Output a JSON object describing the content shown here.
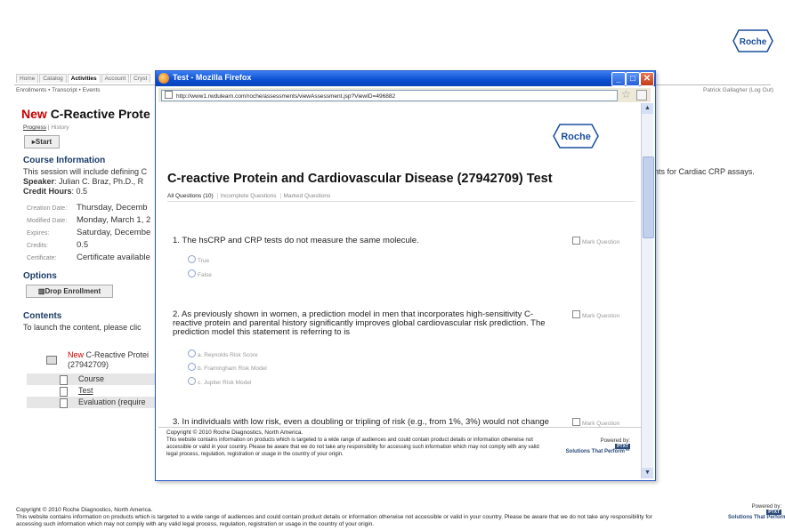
{
  "brand": {
    "logo_text": "Roche",
    "logo_color": "#1a4f9c"
  },
  "nav": {
    "tabs": [
      "Home",
      "Catalog",
      "Activities",
      "Account",
      "Cryst"
    ],
    "active_index": 2
  },
  "subnav": "Enrollments • Transcript • Events",
  "user": "Patrick Gallagher (Log Out)",
  "course": {
    "new_label": "New",
    "title": "C-Reactive Prote",
    "tabs": {
      "progress": "Progress",
      "history": "History"
    },
    "start_label": "Start",
    "info_heading": "Course Information",
    "info_intro": "This session will include defining C",
    "info_tail": "ents for Cardiac CRP assays.",
    "speaker_label": "Speaker",
    "speaker_value": ": Julian C. Braz, Ph.D., R",
    "credit_label": "Credit Hours",
    "credit_value": ": 0.5",
    "details": [
      {
        "key": "Creation Date:",
        "value": "Thursday, Decemb"
      },
      {
        "key": "Modified Date:",
        "value": "Monday, March 1, 2"
      },
      {
        "key": "Expires:",
        "value": "Saturday, Decembe"
      },
      {
        "key": "Credits:",
        "value": "0.5"
      },
      {
        "key": "Certificate:",
        "value": "Certificate available"
      }
    ],
    "options_heading": "Options",
    "drop_label": "Drop Enrollment",
    "contents_heading": "Contents",
    "contents_intro": "To launch the content, please clic",
    "contents_new": "New",
    "contents_title": "C-Reactive Protei",
    "contents_id": "(27942709)",
    "items": [
      "Course",
      "Test",
      "Evaluation (require"
    ]
  },
  "footer": {
    "copyright": "Copyright © 2010 Roche Diagnostics, North America.",
    "disclaimer": "This website contains information on products which is targeted to a wide range of audiences and could contain product details or information otherwise not accessible or valid in your country. Please be aware that we do not take any responsibility for accessing such information which may not comply with any valid legal process, regulation, registration or usage in the country of your origin.",
    "powered_by": "Powered by:",
    "powered_name": "Solutions That Perform™"
  },
  "popup": {
    "window_title": "Test - Mozilla Firefox",
    "url": "http://www1.rwdulearn.com/roche/assessments/viewAssessment.jsp?ViewID=496882",
    "test_title": "C-reactive Protein and Cardiovascular Disease (27942709) Test",
    "tabs": [
      "All Questions (10)",
      "Incomplete Questions",
      "Marked Questions"
    ],
    "mark_label": "Mark Question",
    "questions": [
      {
        "text": "1. The hsCRP and CRP tests do not measure the same molecule.",
        "options": [
          "True",
          "False"
        ]
      },
      {
        "text": "2. As previously shown in women, a prediction model in men that incorporates high-sensitivity C-reactive protein and parental history significantly improves global cardiovascular risk prediction. The prediction model this statement is referring to is",
        "options": [
          "a. Reynolds Risk Score",
          "b. Framingham Risk Model",
          "c. Jupiter Risk Model"
        ]
      },
      {
        "text": "3. In individuals with low risk, even a doubling or tripling of risk (e.g., from 1%, 3%) would not change",
        "options": []
      }
    ],
    "footer_copyright": "Copyright © 2010 Roche Diagnostics, North America.",
    "footer_disclaimer": "This website contains information on products which is targeted to a wide range of audiences and could contain product details or information otherwise not accessible or valid in your country. Please be aware that we do not take any responsibility for accessing such information which may not comply with any valid legal process, regulation, registration or usage in the country of your origin.",
    "powered_by": "Powered by:",
    "powered_name": "Solutions That Perform™"
  }
}
